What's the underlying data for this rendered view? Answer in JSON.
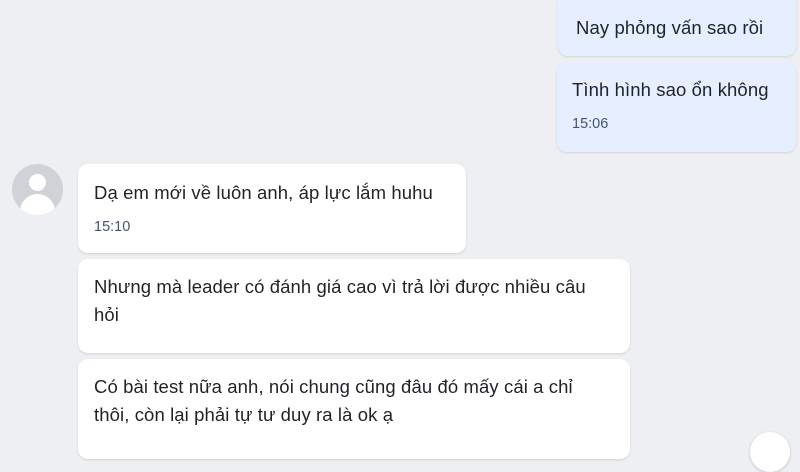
{
  "messages": [
    {
      "direction": "out",
      "text": "Nay phỏng vấn sao rồi",
      "time": ""
    },
    {
      "direction": "out",
      "text": "Tình hình sao ổn không",
      "time": "15:06"
    },
    {
      "direction": "in",
      "text": "Dạ em mới về luôn anh, áp lực lắm huhu",
      "time": "15:10"
    },
    {
      "direction": "in",
      "text": "Nhưng mà leader có đánh giá cao vì trả lời được nhiều câu hỏi",
      "time": ""
    },
    {
      "direction": "in",
      "text": "Có bài test nữa anh, nói chung cũng đâu đó mấy cái a chỉ thôi, còn lại phải tự tư duy ra là ok ạ",
      "time": ""
    }
  ],
  "contact": {
    "avatar_icon": "default-user-avatar-icon"
  },
  "colors": {
    "background": "#eeeff2",
    "outgoing_bubble": "#e5efff",
    "incoming_bubble": "#ffffff",
    "time_text": "#44546a"
  }
}
